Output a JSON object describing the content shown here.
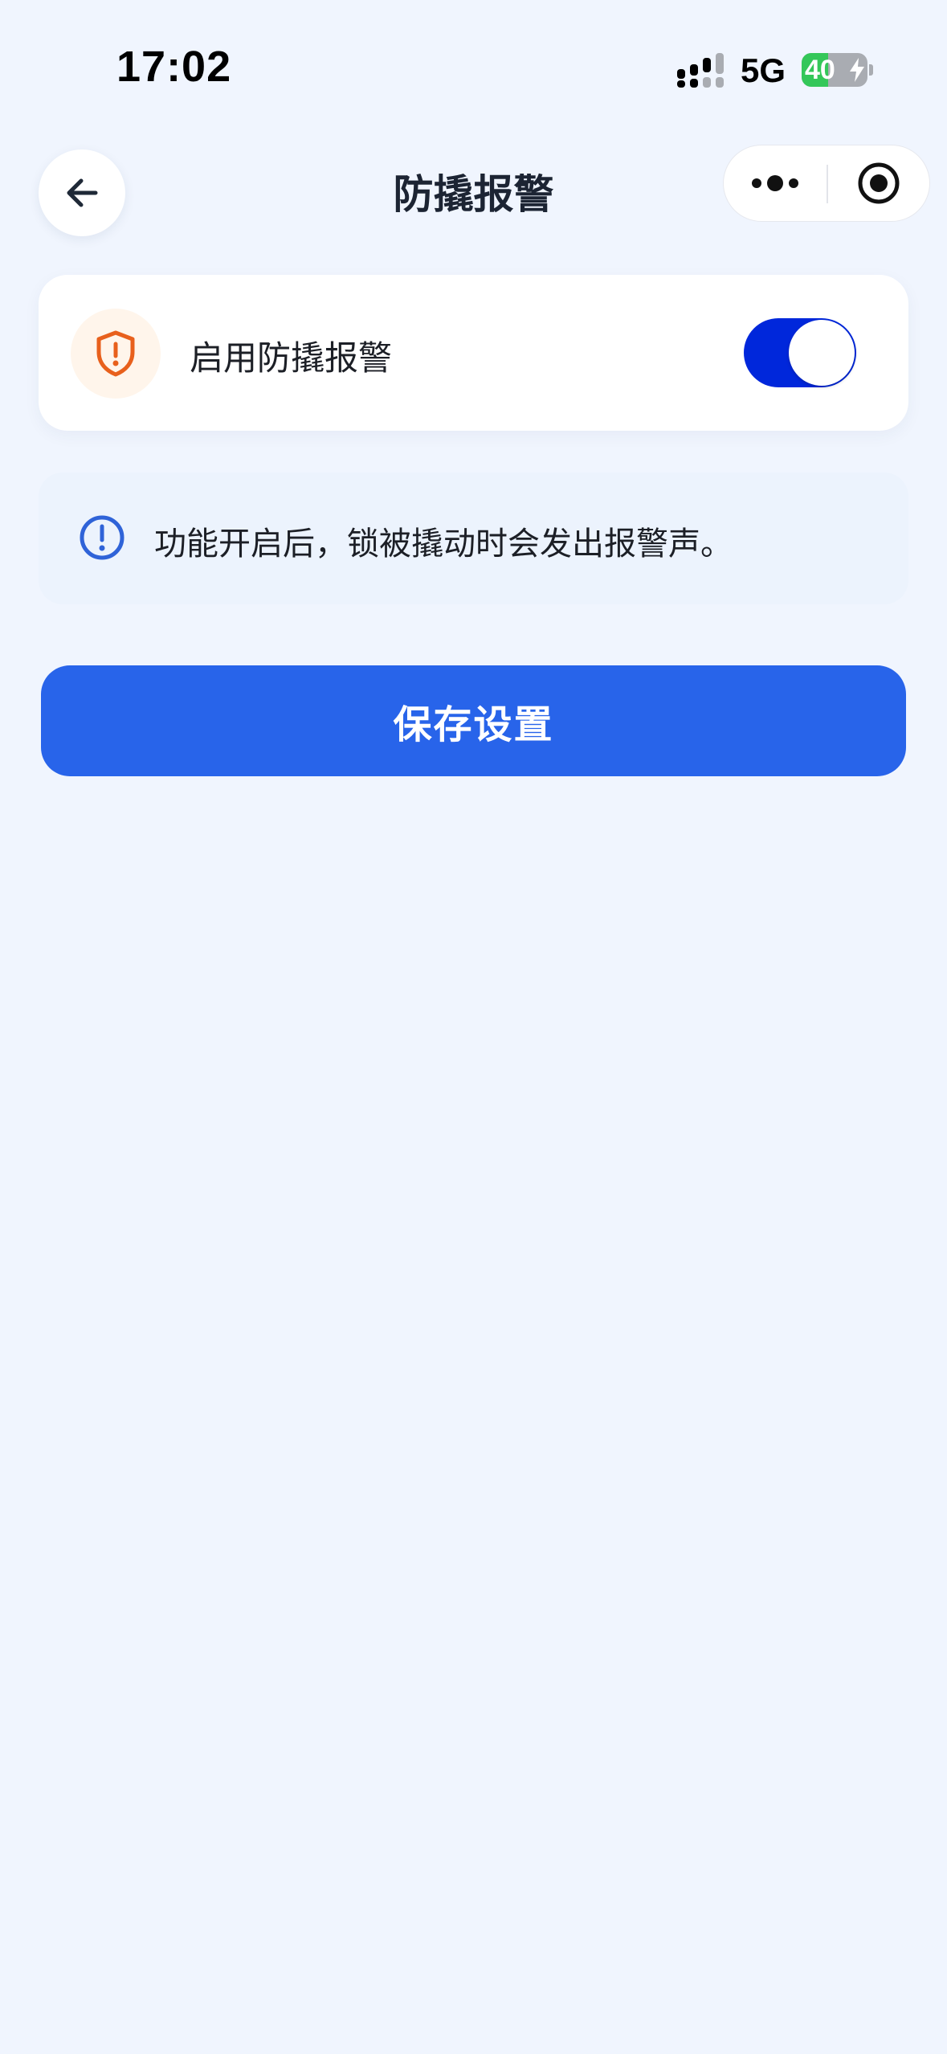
{
  "status_bar": {
    "time": "17:02",
    "network": "5G",
    "battery_level": "40",
    "battery_percent": 40,
    "signal_icon": "cellular-signal-icon",
    "charging_icon": "lightning-bolt-icon"
  },
  "nav": {
    "title": "防撬报警",
    "back_icon": "arrow-left-icon",
    "more_icon": "more-dots-icon",
    "close_icon": "target-circle-icon"
  },
  "alarm_card": {
    "icon": "shield-alert-icon",
    "label": "启用防撬报警",
    "enabled": true
  },
  "info": {
    "icon": "info-circle-icon",
    "text": "功能开启后，锁被撬动时会发出报警声。"
  },
  "actions": {
    "save_label": "保存设置"
  },
  "colors": {
    "background": "#f0f5fe",
    "toggle_on": "#0027db",
    "primary_button": "#2864ea",
    "shield_accent": "#e8601c",
    "info_accent": "#2f63d8",
    "info_bg": "#ecf3fd",
    "battery_green": "#34c759"
  }
}
